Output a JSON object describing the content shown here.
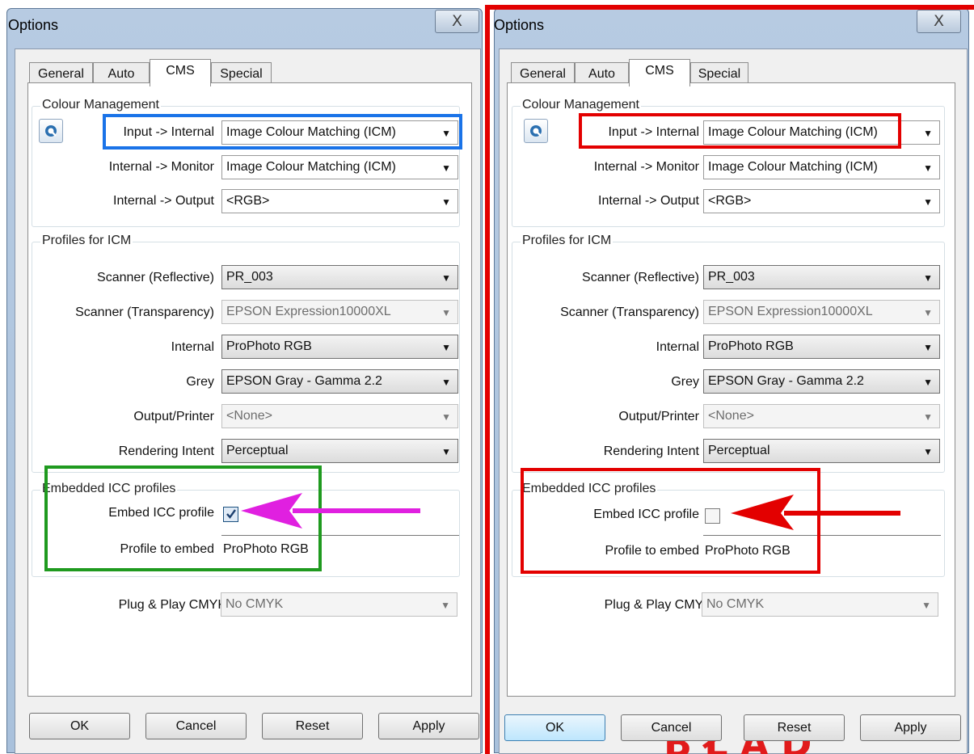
{
  "windows": [
    {
      "title": "Options",
      "close_glyph": "X",
      "tabs": [
        "General",
        "Auto",
        "CMS",
        "Special"
      ],
      "active_tab": "CMS",
      "colour_management": {
        "title": "Colour Management",
        "icon": "colour-management-icon",
        "rows": [
          {
            "label": "Input -> Internal",
            "value": "Image Colour Matching (ICM)"
          },
          {
            "label": "Internal -> Monitor",
            "value": "Image Colour Matching (ICM)"
          },
          {
            "label": "Internal -> Output",
            "value": "<RGB>"
          }
        ]
      },
      "profiles": {
        "title": "Profiles for ICM",
        "rows": [
          {
            "label": "Scanner (Reflective)",
            "value": "PR_003",
            "enabled": true
          },
          {
            "label": "Scanner (Transparency)",
            "value": "EPSON Expression10000XL",
            "enabled": false
          },
          {
            "label": "Internal",
            "value": "ProPhoto RGB",
            "enabled": true
          },
          {
            "label": "Grey",
            "value": "EPSON  Gray - Gamma 2.2",
            "enabled": true
          },
          {
            "label": "Output/Printer",
            "value": "<None>",
            "enabled": false
          },
          {
            "label": "Rendering Intent",
            "value": "Perceptual",
            "enabled": true
          }
        ]
      },
      "embedded": {
        "title": "Embedded ICC profiles",
        "embed_label": "Embed ICC profile",
        "embed_checked": true,
        "profile_label": "Profile to embed",
        "profile_value": "ProPhoto RGB"
      },
      "plug_play": {
        "label": "Plug & Play CMYK",
        "value": "No CMYK"
      },
      "buttons": [
        "OK",
        "Cancel",
        "Reset",
        "Apply"
      ],
      "annotations": {
        "input_box_color": "#1a73e8",
        "embed_box_color": "#1f9a1f",
        "arrow_color": "#e020e0"
      }
    },
    {
      "title": "Options",
      "close_glyph": "X",
      "tabs": [
        "General",
        "Auto",
        "CMS",
        "Special"
      ],
      "active_tab": "CMS",
      "colour_management": {
        "title": "Colour Management",
        "icon": "colour-management-icon",
        "rows": [
          {
            "label": "Input -> Internal",
            "value": "Image Colour Matching (ICM)"
          },
          {
            "label": "Internal -> Monitor",
            "value": "Image Colour Matching (ICM)"
          },
          {
            "label": "Internal -> Output",
            "value": "<RGB>"
          }
        ]
      },
      "profiles": {
        "title": "Profiles for ICM",
        "rows": [
          {
            "label": "Scanner (Reflective)",
            "value": "PR_003",
            "enabled": true
          },
          {
            "label": "Scanner (Transparency)",
            "value": "EPSON Expression10000XL",
            "enabled": false
          },
          {
            "label": "Internal",
            "value": "ProPhoto RGB",
            "enabled": true
          },
          {
            "label": "Grey",
            "value": "EPSON  Gray - Gamma 2.2",
            "enabled": true
          },
          {
            "label": "Output/Printer",
            "value": "<None>",
            "enabled": false
          },
          {
            "label": "Rendering Intent",
            "value": "Perceptual",
            "enabled": true
          }
        ]
      },
      "embedded": {
        "title": "Embedded ICC profiles",
        "embed_label": "Embed ICC profile",
        "embed_checked": false,
        "profile_label": "Profile to embed",
        "profile_value": "ProPhoto RGB"
      },
      "plug_play": {
        "label": "Plug & Play CMYK",
        "value": "No CMYK"
      },
      "buttons": [
        "OK",
        "Cancel",
        "Reset",
        "Apply"
      ],
      "error_text": "BŁĄD",
      "annotations": {
        "input_box_color": "#e30000",
        "embed_box_color": "#e30000",
        "arrow_color": "#e30000"
      }
    }
  ],
  "divider_color": "#e30000"
}
